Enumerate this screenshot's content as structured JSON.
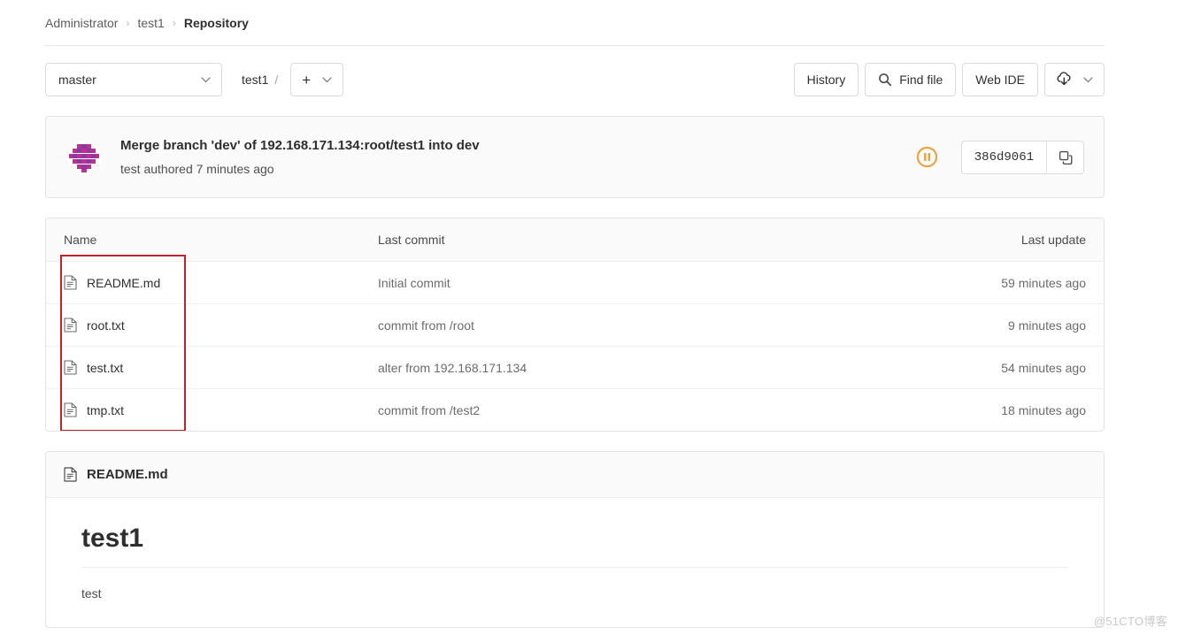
{
  "breadcrumb": {
    "items": [
      {
        "label": "Administrator",
        "current": false
      },
      {
        "label": "test1",
        "current": false
      },
      {
        "label": "Repository",
        "current": true
      }
    ],
    "separator": "›"
  },
  "toolbar": {
    "branch": "master",
    "path_root": "test1",
    "path_separator": "/",
    "add_plus": "+",
    "caret": "∨",
    "history_label": "History",
    "find_file_label": "Find file",
    "web_ide_label": "Web IDE"
  },
  "commit": {
    "title": "Merge branch 'dev' of 192.168.171.134:root/test1 into dev",
    "subtitle": "test authored 7 minutes ago",
    "sha": "386d9061",
    "ci_status": "pending",
    "ci_status_color": "#e9a13b"
  },
  "files": {
    "headers": {
      "name": "Name",
      "last_commit": "Last commit",
      "last_update": "Last update"
    },
    "rows": [
      {
        "name": "README.md",
        "last_commit": "Initial commit",
        "last_update": "59 minutes ago"
      },
      {
        "name": "root.txt",
        "last_commit": "commit from /root",
        "last_update": "9 minutes ago"
      },
      {
        "name": "test.txt",
        "last_commit": "alter from 192.168.171.134",
        "last_update": "54 minutes ago"
      },
      {
        "name": "tmp.txt",
        "last_commit": "commit from /test2",
        "last_update": "18 minutes ago"
      }
    ]
  },
  "readme": {
    "filename": "README.md",
    "heading": "test1",
    "paragraph": "test"
  },
  "watermark": "@51CTO博客",
  "colors": {
    "annotation": "#c0242a",
    "ci_pending": "#e9a13b",
    "avatar_primary": "#bb3a8f",
    "avatar_secondary": "#8a3aa8"
  }
}
